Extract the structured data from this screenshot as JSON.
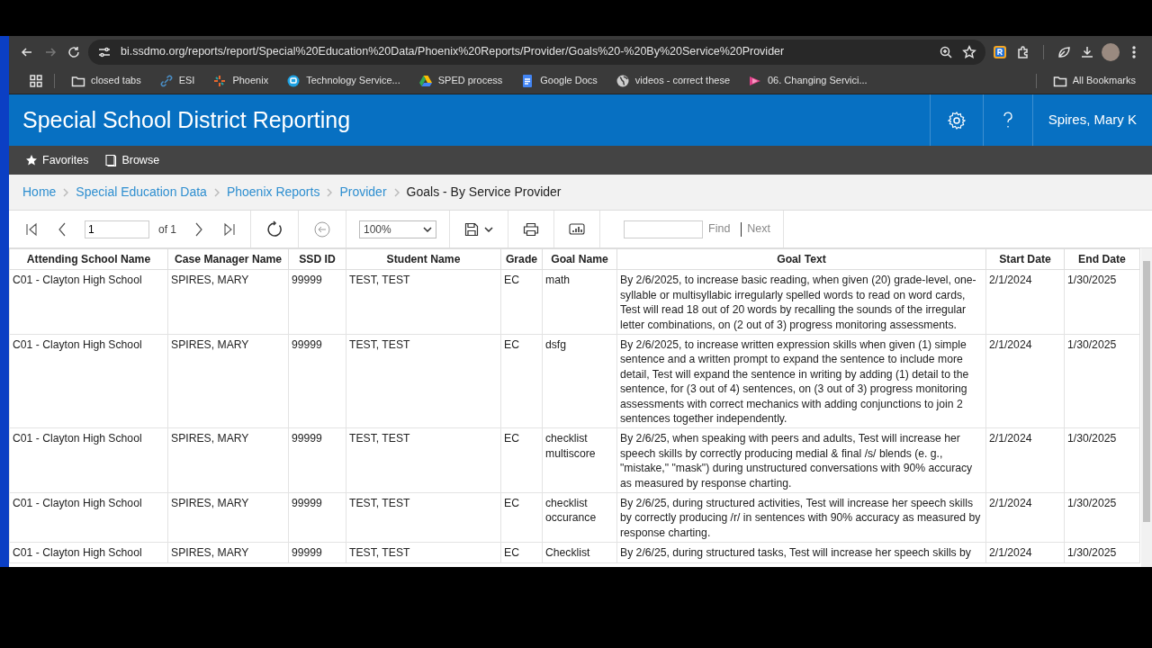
{
  "browser": {
    "back_disabled": false,
    "forward_disabled": true,
    "url": "bi.ssdmo.org/reports/report/Special%20Education%20Data/Phoenix%20Reports/Provider/Goals%20-%20By%20Service%20Provider"
  },
  "bookmarks": [
    {
      "kind": "folder",
      "label": "closed tabs"
    },
    {
      "kind": "link",
      "label": "ESI"
    },
    {
      "kind": "spark",
      "label": "Phoenix"
    },
    {
      "kind": "circle",
      "label": "Technology Service..."
    },
    {
      "kind": "drive",
      "label": "SPED process"
    },
    {
      "kind": "doc",
      "label": "Google Docs"
    },
    {
      "kind": "globe",
      "label": "videos - correct these"
    },
    {
      "kind": "play",
      "label": "06. Changing Servici..."
    }
  ],
  "all_bookmarks": "All Bookmarks",
  "app": {
    "title": "Special School District Reporting",
    "user": "Spires, Mary K"
  },
  "menu": [
    {
      "kind": "favorites",
      "label": "Favorites"
    },
    {
      "kind": "browse",
      "label": "Browse"
    }
  ],
  "breadcrumb": [
    {
      "label": "Home",
      "current": false
    },
    {
      "label": "Special Education Data",
      "current": false
    },
    {
      "label": "Phoenix Reports",
      "current": false
    },
    {
      "label": "Provider",
      "current": false
    },
    {
      "label": "Goals - By Service Provider",
      "current": true
    }
  ],
  "toolbar": {
    "page": "1",
    "of": "of 1",
    "zoom": "100%",
    "find": "Find",
    "next": "Next",
    "find_disabled": true
  },
  "table": {
    "columns": [
      "Attending School Name",
      "Case Manager Name",
      "SSD ID",
      "Student Name",
      "Grade",
      "Goal Name",
      "Goal Text",
      "Start Date",
      "End Date"
    ],
    "rows": [
      [
        "C01 - Clayton High School",
        "SPIRES, MARY",
        "99999",
        "TEST, TEST",
        "EC",
        "math",
        "By 2/6/2025, to increase basic reading, when given (20) grade-level, one-syllable or multisyllabic irregularly spelled words to read on word cards, Test will read 18 out of 20 words by recalling the sounds of the irregular letter combinations, on (2 out of 3) progress monitoring assessments.",
        "2/1/2024",
        "1/30/2025"
      ],
      [
        "C01 - Clayton High School",
        "SPIRES, MARY",
        "99999",
        "TEST, TEST",
        "EC",
        "dsfg",
        "By 2/6/2025, to increase written expression skills when given (1) simple sentence and a written prompt to expand the sentence to include more detail, Test will expand the sentence in writing by adding (1) detail to the sentence, for (3 out of 4) sentences, on (3 out of 3) progress monitoring assessments with correct mechanics with adding conjunctions to join 2 sentences together independently.",
        "2/1/2024",
        "1/30/2025"
      ],
      [
        "C01 - Clayton High School",
        "SPIRES, MARY",
        "99999",
        "TEST, TEST",
        "EC",
        "checklist multiscore",
        "By 2/6/25, when speaking with peers and adults, Test will increase her speech skills by correctly producing medial & final /s/ blends (e. g., \"mistake,\" \"mask\") during unstructured conversations with 90% accuracy as measured by response charting.",
        "2/1/2024",
        "1/30/2025"
      ],
      [
        "C01 - Clayton High School",
        "SPIRES, MARY",
        "99999",
        "TEST, TEST",
        "EC",
        "checklist occurance",
        "By 2/6/25, during structured activities, Test will increase her speech skills by correctly producing /r/ in sentences with 90% accuracy as measured by response charting.",
        "2/1/2024",
        "1/30/2025"
      ],
      [
        "C01 - Clayton High School",
        "SPIRES, MARY",
        "99999",
        "TEST, TEST",
        "EC",
        "Checklist",
        "By 2/6/25, during structured tasks, Test will increase her speech skills by",
        "2/1/2024",
        "1/30/2025"
      ]
    ]
  }
}
